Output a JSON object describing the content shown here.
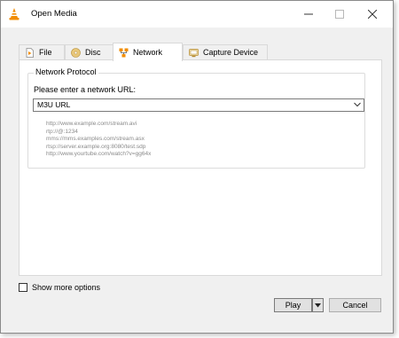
{
  "window": {
    "title": "Open Media",
    "controls": {
      "minimize": "minimize",
      "maximize": "maximize",
      "close": "close"
    }
  },
  "tabs": [
    {
      "label": "File",
      "icon": "file-icon",
      "active": false
    },
    {
      "label": "Disc",
      "icon": "disc-icon",
      "active": false
    },
    {
      "label": "Network",
      "icon": "network-icon",
      "active": true
    },
    {
      "label": "Capture Device",
      "icon": "capture-device-icon",
      "active": false
    }
  ],
  "network": {
    "group_title": "Network Protocol",
    "prompt": "Please enter a network URL:",
    "url_value": "M3U URL",
    "examples": [
      "http://www.example.com/stream.avi",
      "rtp://@:1234",
      "mms://mms.examples.com/stream.asx",
      "rtsp://server.example.org:8080/test.sdp",
      "http://www.yourtube.com/watch?v=gg64x"
    ]
  },
  "options": {
    "show_more_label": "Show more options",
    "show_more_checked": false
  },
  "buttons": {
    "play": "Play",
    "cancel": "Cancel"
  },
  "colors": {
    "accent_orange": "#f28c00",
    "window_bg": "#f0f0f0",
    "panel_bg": "#ffffff"
  }
}
